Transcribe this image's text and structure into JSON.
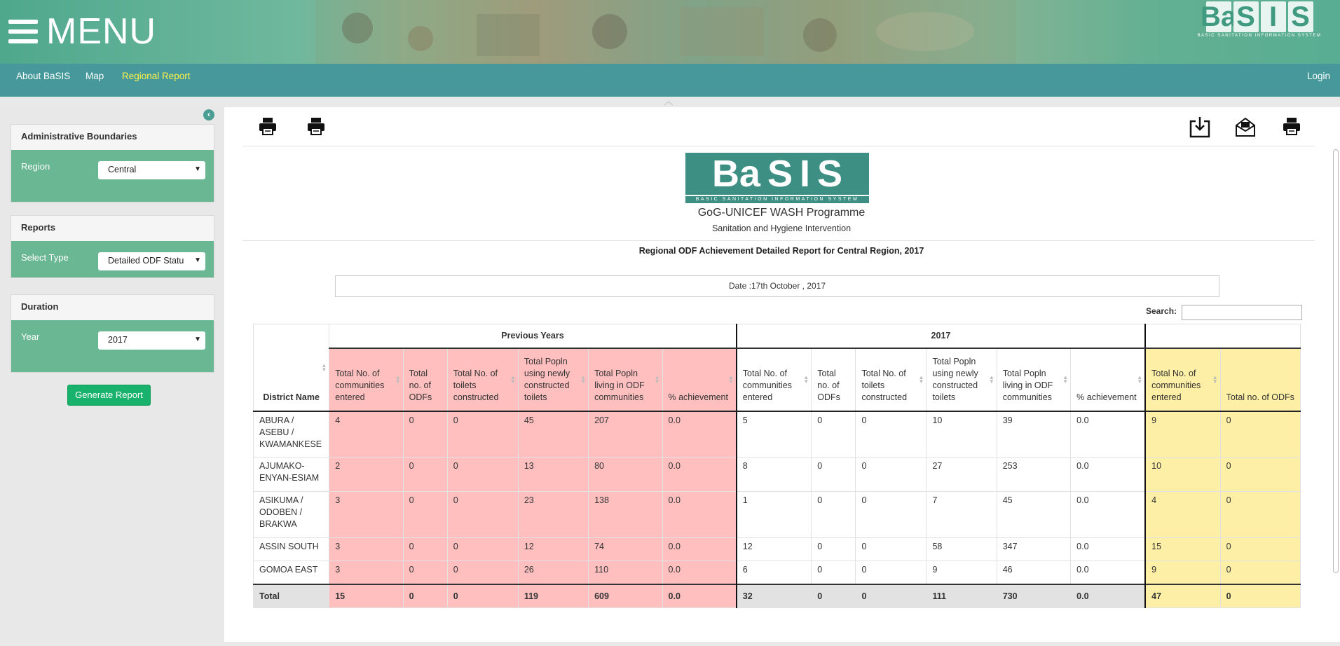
{
  "header": {
    "menu_label": "MENU",
    "brand_letters": [
      "Ba",
      "S",
      "I",
      "S"
    ],
    "brand_sub": "BASIC SANITATION INFORMATION SYSTEM"
  },
  "nav": {
    "items": [
      "About BaSIS",
      "Map",
      "Regional Report"
    ],
    "login": "Login"
  },
  "sidebar": {
    "panels": [
      {
        "title": "Administrative Boundaries",
        "label": "Region",
        "value": "Central"
      },
      {
        "title": "Reports",
        "label": "Select Type",
        "value": "Detailed ODF Statu"
      },
      {
        "title": "Duration",
        "label": "Year",
        "value": "2017"
      }
    ],
    "generate_button": "Generate Report"
  },
  "report": {
    "logo_letters": [
      "Ba",
      "S",
      "I",
      "S"
    ],
    "logo_sub": "BASIC SANITATION INFORMATION SYSTEM",
    "programme": "GoG-UNICEF WASH Programme",
    "subtitle": "Sanitation and Hygiene Intervention",
    "title": "Regional ODF Achievement Detailed Report for Central Region, 2017",
    "date": "Date :17th October , 2017",
    "search_label": "Search:"
  },
  "table": {
    "groups": [
      "Previous Years",
      "2017"
    ],
    "district_header": "District Name",
    "columns": [
      "Total No. of communities entered",
      "Total no. of ODFs",
      "Total No. of toilets constructed",
      "Total Popln using newly constructed toilets",
      "Total Popln living in ODF communities",
      "% achievement"
    ],
    "cut_columns": [
      "Total No. of communities entered",
      "Total no. of ODFs"
    ],
    "rows": [
      {
        "district": "ABURA / ASEBU / KWAMANKESE",
        "prev": [
          "4",
          "0",
          "0",
          "45",
          "207",
          "0.0"
        ],
        "cur": [
          "5",
          "0",
          "0",
          "10",
          "39",
          "0.0"
        ],
        "tot": [
          "9",
          "0"
        ]
      },
      {
        "district": "AJUMAKO-ENYAN-ESIAM",
        "prev": [
          "2",
          "0",
          "0",
          "13",
          "80",
          "0.0"
        ],
        "cur": [
          "8",
          "0",
          "0",
          "27",
          "253",
          "0.0"
        ],
        "tot": [
          "10",
          "0"
        ]
      },
      {
        "district": "ASIKUMA / ODOBEN / BRAKWA",
        "prev": [
          "3",
          "0",
          "0",
          "23",
          "138",
          "0.0"
        ],
        "cur": [
          "1",
          "0",
          "0",
          "7",
          "45",
          "0.0"
        ],
        "tot": [
          "4",
          "0"
        ]
      },
      {
        "district": "ASSIN SOUTH",
        "prev": [
          "3",
          "0",
          "0",
          "12",
          "74",
          "0.0"
        ],
        "cur": [
          "12",
          "0",
          "0",
          "58",
          "347",
          "0.0"
        ],
        "tot": [
          "15",
          "0"
        ]
      },
      {
        "district": "GOMOA EAST",
        "prev": [
          "3",
          "0",
          "0",
          "26",
          "110",
          "0.0"
        ],
        "cur": [
          "6",
          "0",
          "0",
          "9",
          "46",
          "0.0"
        ],
        "tot": [
          "9",
          "0"
        ]
      }
    ],
    "total": {
      "label": "Total",
      "prev": [
        "15",
        "0",
        "0",
        "119",
        "609",
        "0.0"
      ],
      "cur": [
        "32",
        "0",
        "0",
        "111",
        "730",
        "0.0"
      ],
      "tot": [
        "47",
        "0"
      ]
    }
  }
}
